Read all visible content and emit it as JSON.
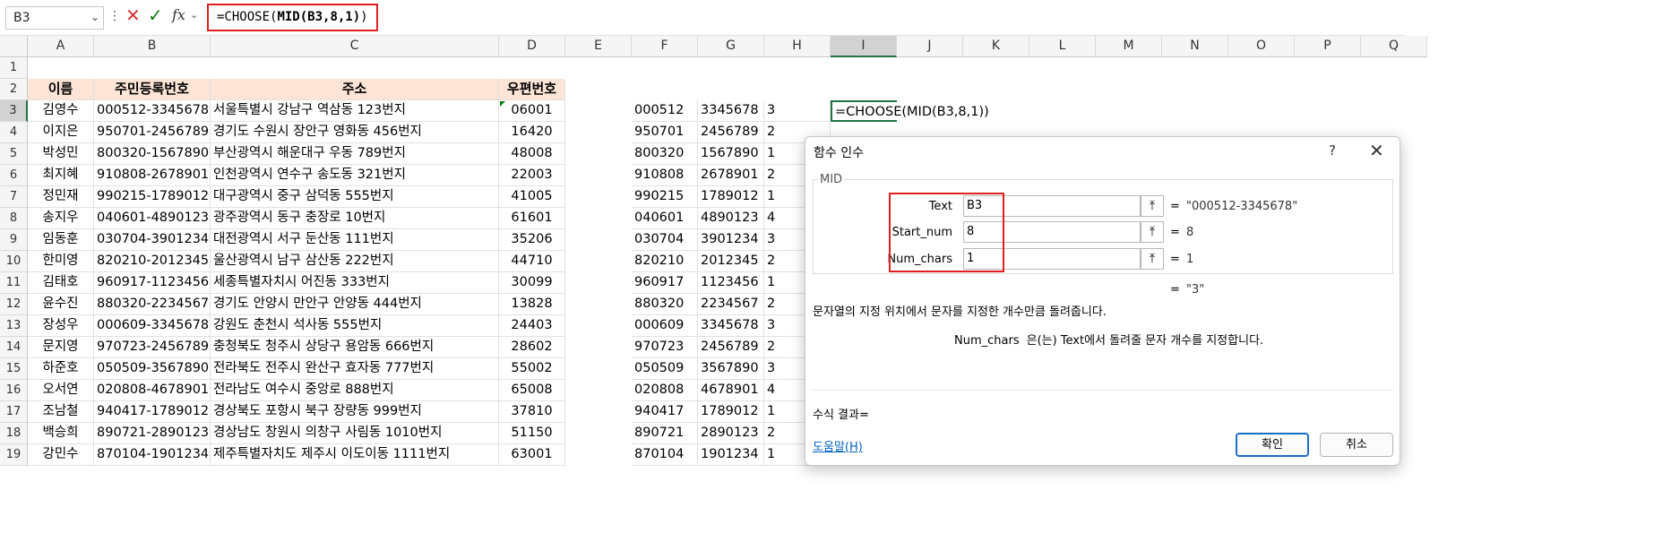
{
  "formula_bar": {
    "name_box": "B3",
    "formula_prefix": "=CHOOSE(",
    "formula_mid": "MID(B3,8,1)",
    "formula_suffix": ")",
    "fx_label": "fx"
  },
  "columns": [
    "A",
    "B",
    "C",
    "D",
    "E",
    "F",
    "G",
    "H",
    "I",
    "J",
    "K",
    "L",
    "M",
    "N",
    "O",
    "P",
    "Q"
  ],
  "selected_column": "I",
  "selected_row": 3,
  "rows": [
    "1",
    "2",
    "3",
    "4",
    "5",
    "6",
    "7",
    "8",
    "9",
    "10",
    "11",
    "12",
    "13",
    "14",
    "15",
    "16",
    "17",
    "18",
    "19"
  ],
  "headers": {
    "name": "이름",
    "rrn": "주민등록번호",
    "address": "주소",
    "zip": "우편번호"
  },
  "records": [
    [
      "김영수",
      "000512-3345678",
      "서울특별시 강남구 역삼동 123번지",
      "06001",
      "000512",
      "3345678",
      "3"
    ],
    [
      "이지은",
      "950701-2456789",
      "경기도 수원시 장안구 영화동 456번지",
      "16420",
      "950701",
      "2456789",
      "2"
    ],
    [
      "박성민",
      "800320-1567890",
      "부산광역시 해운대구 우동 789번지",
      "48008",
      "800320",
      "1567890",
      "1"
    ],
    [
      "최지혜",
      "910808-2678901",
      "인천광역시 연수구 송도동 321번지",
      "22003",
      "910808",
      "2678901",
      "2"
    ],
    [
      "정민재",
      "990215-1789012",
      "대구광역시 중구 삼덕동 555번지",
      "41005",
      "990215",
      "1789012",
      "1"
    ],
    [
      "송지우",
      "040601-4890123",
      "광주광역시 동구 충장로 10번지",
      "61601",
      "040601",
      "4890123",
      "4"
    ],
    [
      "임동훈",
      "030704-3901234",
      "대전광역시 서구 둔산동 111번지",
      "35206",
      "030704",
      "3901234",
      "3"
    ],
    [
      "한미영",
      "820210-2012345",
      "울산광역시 남구 삼산동 222번지",
      "44710",
      "820210",
      "2012345",
      "2"
    ],
    [
      "김태호",
      "960917-1123456",
      "세종특별자치시 어진동 333번지",
      "30099",
      "960917",
      "1123456",
      "1"
    ],
    [
      "윤수진",
      "880320-2234567",
      "경기도 안양시 만안구 안양동 444번지",
      "13828",
      "880320",
      "2234567",
      "2"
    ],
    [
      "장성우",
      "000609-3345678",
      "강원도 춘천시 석사동 555번지",
      "24403",
      "000609",
      "3345678",
      "3"
    ],
    [
      "문지영",
      "970723-2456789",
      "충청북도 청주시 상당구 용암동 666번지",
      "28602",
      "970723",
      "2456789",
      "2"
    ],
    [
      "하준호",
      "050509-3567890",
      "전라북도 전주시 완산구 효자동 777번지",
      "55002",
      "050509",
      "3567890",
      "3"
    ],
    [
      "오서연",
      "020808-4678901",
      "전라남도 여수시 중앙로 888번지",
      "65008",
      "020808",
      "4678901",
      "4"
    ],
    [
      "조남철",
      "940417-1789012",
      "경상북도 포항시 북구 장량동 999번지",
      "37810",
      "940417",
      "1789012",
      "1"
    ],
    [
      "백승희",
      "890721-2890123",
      "경상남도 창원시 의창구 사림동 1010번지",
      "51150",
      "890721",
      "2890123",
      "2"
    ],
    [
      "강민수",
      "870104-1901234",
      "제주특별자치도 제주시 이도이동 1111번지",
      "63001",
      "870104",
      "1901234",
      "1"
    ]
  ],
  "i3_cell": "=CHOOSE(MID(B3,8,1))",
  "dialog": {
    "title": "함수 인수",
    "help_symbol": "?",
    "function_name": "MID",
    "args": [
      {
        "label": "Text",
        "value": "B3",
        "result": "\"000512-3345678\""
      },
      {
        "label": "Start_num",
        "value": "8",
        "result": "8"
      },
      {
        "label": "Num_chars",
        "value": "1",
        "result": "1"
      }
    ],
    "equals": "=",
    "overall_result": "\"3\"",
    "description": "문자열의 지정 위치에서 문자를 지정한 개수만큼 돌려줍니다.",
    "arg_desc_name": "Num_chars",
    "arg_desc_text": "은(는) Text에서 돌려줄 문자 개수를 지정합니다.",
    "formula_result_label": "수식 결과=",
    "help_link": "도움말(H)",
    "ok_label": "확인",
    "cancel_label": "취소"
  }
}
